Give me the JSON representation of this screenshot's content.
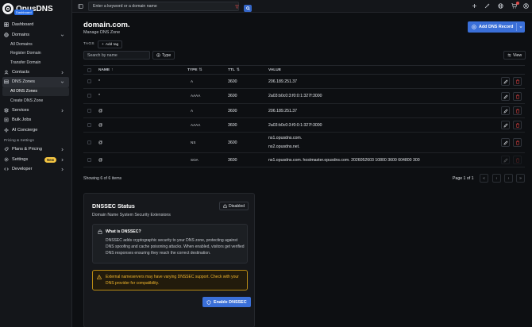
{
  "app": {
    "name": "OpusDNS",
    "badge": "Dashboard"
  },
  "sidebar": {
    "items": [
      {
        "label": "Dashboard",
        "icon": "dashboard-icon"
      },
      {
        "label": "Domains",
        "icon": "globe-icon",
        "sub": [
          "All Domains",
          "Register Domain",
          "Transfer Domain"
        ]
      },
      {
        "label": "Contacts",
        "icon": "contacts-icon"
      },
      {
        "label": "DNS Zones",
        "icon": "server-icon",
        "sub": [
          "All DNS Zones",
          "Create DNS Zone"
        ]
      },
      {
        "label": "Services",
        "icon": "services-icon"
      },
      {
        "label": "Bulk Jobs",
        "icon": "bulk-jobs-icon"
      },
      {
        "label": "AI Concierge",
        "icon": "ai-sparkle-icon"
      }
    ],
    "section_label": "Pricing & Settings",
    "bottom_items": [
      {
        "label": "Plans & Pricing",
        "icon": "plans-icon"
      },
      {
        "label": "Settings",
        "icon": "settings-icon",
        "badge": "New"
      },
      {
        "label": "Developer",
        "icon": "code-icon"
      }
    ]
  },
  "topbar": {
    "search_placeholder": "Enter a keyword or a domain name"
  },
  "page": {
    "title": "domain.com.",
    "subtitle": "Manage DNS Zone",
    "add_button": "Add DNS Record",
    "tags_label": "TAGS",
    "add_tag": "Add tag",
    "filter_placeholder": "Search by name",
    "type_filter": "Type",
    "view_button": "View"
  },
  "table": {
    "headers": {
      "name": "NAME",
      "type": "TYPE",
      "ttl": "TTL",
      "value": "VALUE"
    },
    "rows": [
      {
        "name": "*",
        "type": "A",
        "ttl": "3600",
        "value": [
          "206.189.251.37"
        ]
      },
      {
        "name": "*",
        "type": "AAAA",
        "ttl": "3600",
        "value": [
          "2a03:b0c0:3:f0:0:1:327f:3000"
        ]
      },
      {
        "name": "@",
        "type": "A",
        "ttl": "3600",
        "value": [
          "206.189.251.37"
        ]
      },
      {
        "name": "@",
        "type": "AAAA",
        "ttl": "3600",
        "value": [
          "2a03:b0c0:3:f0:0:1:327f:3000"
        ]
      },
      {
        "name": "@",
        "type": "NS",
        "ttl": "3600",
        "value": [
          "ns1.opusdns.com.",
          "ns2.opusdns.net."
        ]
      },
      {
        "name": "@",
        "type": "SOA",
        "ttl": "3600",
        "value": [
          "ns1.opusdns.com. hostmaster.opusdns.com. 2026052603 10800 3600 604800 300"
        ]
      }
    ],
    "showing": "Showing 6 of 6 items",
    "page_label": "Page 1 of 1"
  },
  "dnssec": {
    "title": "DNSSEC Status",
    "subtitle": "Domain Name System Security Extensions",
    "status": "Disabled",
    "info_title": "What is DNSSEC?",
    "info_text": "DNSSEC adds cryptographic security to your DNS zone, protecting against DNS spoofing and cache poisoning attacks. When enabled, visitors get verified DNS responses ensuring they reach the correct destination.",
    "warning": "External nameservers may have varying DNSSEC support. Check with your DNS provider for compatibility.",
    "enable_button": "Enable DNSSEC"
  },
  "colors": {
    "accent": "#3a6fd8",
    "danger": "#c23a3a",
    "warning": "#f2b62c",
    "new_badge": "#f4c542"
  }
}
